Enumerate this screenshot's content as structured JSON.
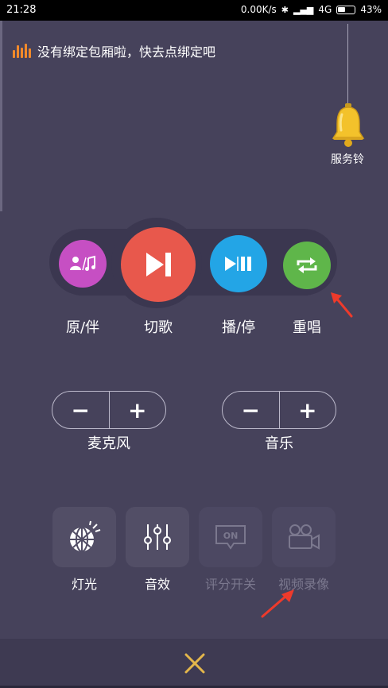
{
  "status_bar": {
    "time": "21:28",
    "net_speed": "0.00K/s",
    "network": "4G",
    "battery": "43%"
  },
  "notice": {
    "text": "没有绑定包厢啦，快去点绑定吧"
  },
  "service_bell": {
    "label": "服务铃"
  },
  "playback": {
    "original": "原/伴",
    "skip": "切歌",
    "play_pause": "播/停",
    "replay": "重唱"
  },
  "mic": {
    "label": "麦克风",
    "minus": "−",
    "plus": "+"
  },
  "music": {
    "label": "音乐",
    "minus": "−",
    "plus": "+"
  },
  "tools": {
    "light": "灯光",
    "effects": "音效",
    "score": "评分开关",
    "score_badge": "ON",
    "video": "视频录像"
  },
  "colors": {
    "background": "#46425b",
    "original": "#c64fc3",
    "skip": "#e8584c",
    "play": "#23a5e6",
    "replay": "#5fb64a",
    "close": "#e3b64b"
  }
}
